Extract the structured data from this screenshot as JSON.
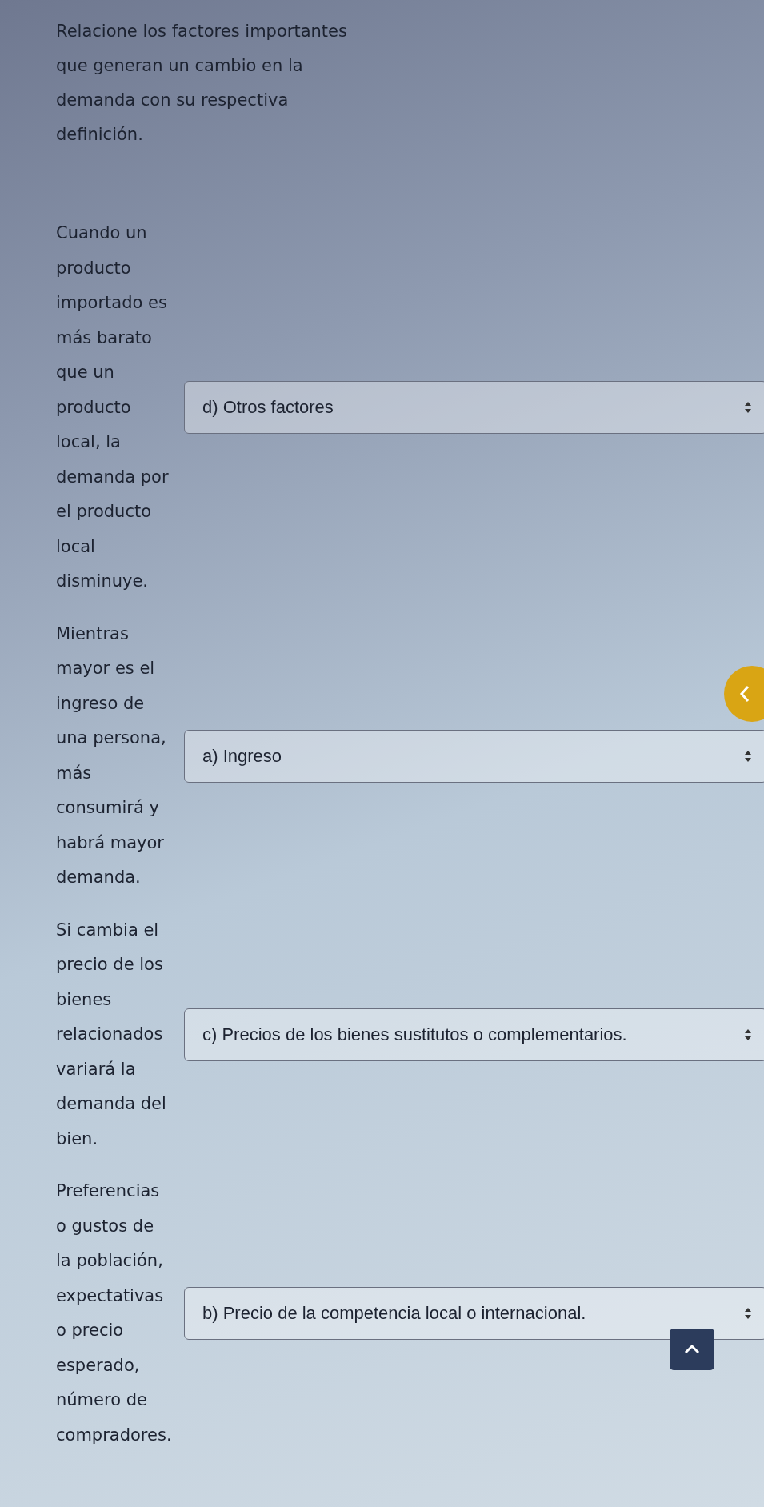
{
  "question": {
    "title": "Relacione los factores importantes que generan un cambio en la demanda con su respectiva definición."
  },
  "rows": [
    {
      "definition": "Cuando un producto importado es más barato que un producto local, la demanda por el producto local disminuye.",
      "answer": "d) Otros factores"
    },
    {
      "definition": "Mientras mayor es el ingreso de una persona, más consumirá y habrá mayor demanda.",
      "answer": "a) Ingreso"
    },
    {
      "definition": "Si cambia el precio de los bienes relacionados variará la demanda del bien.",
      "answer": "c) Precios de los bienes sustitutos o complementarios."
    },
    {
      "definition": "Preferencias o gustos de la población, expectativas o precio esperado, número de compradores.",
      "answer": "b) Precio de la competencia local o internacional."
    }
  ]
}
